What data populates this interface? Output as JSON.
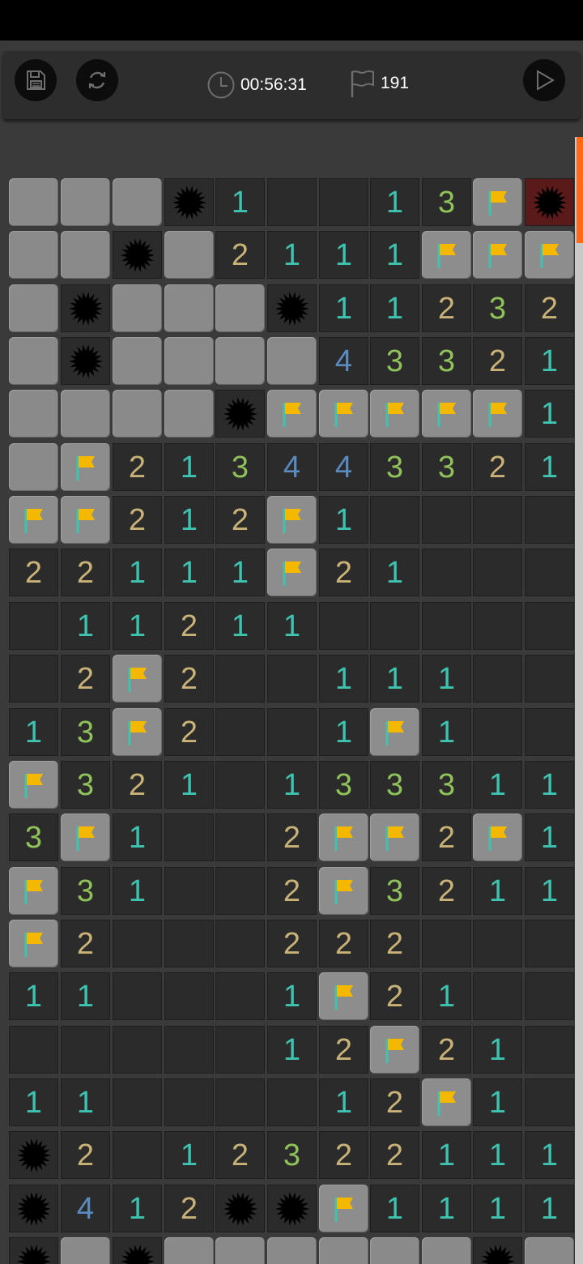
{
  "header": {
    "timer": "00:56:31",
    "flag_count": "191"
  },
  "theme": {
    "number_colors": {
      "1": "#3ec3b0",
      "2": "#c9b277",
      "3": "#8fc35a",
      "4": "#5a8bbf"
    },
    "flag_color": "#f5b800",
    "mine_color": "#000000",
    "exploded_bg": "#5a1a1a",
    "scroll_accent": "#ff6a1a"
  },
  "board": {
    "legend": {
      "H": "hidden",
      "E": "revealed-empty",
      "F": "flag",
      "M": "mine",
      "X": "exploded-mine",
      "1-8": "number"
    },
    "rows": [
      "HHHM1EE13FX",
      "HHMH2111FFF",
      "HMHHHM11232",
      "HMHHHH43321",
      "HHHHMFFFFF1",
      "HF213443321",
      "FF212F1EEEE",
      "22111F21EEEE",
      "E11211EEEEE",
      "E2F2EE111EE",
      "13F2EE1F1EE",
      "F321E133311",
      "3F1EE2FF2F1",
      "F31EE2F3211",
      "F2EEE222EEE",
      "11EEE1F21EE",
      "EEEEE12F21E",
      "11EEEE12F1E",
      "M2E12322111",
      "M412MMF1111",
      "MHMHHHHHHMH"
    ]
  }
}
